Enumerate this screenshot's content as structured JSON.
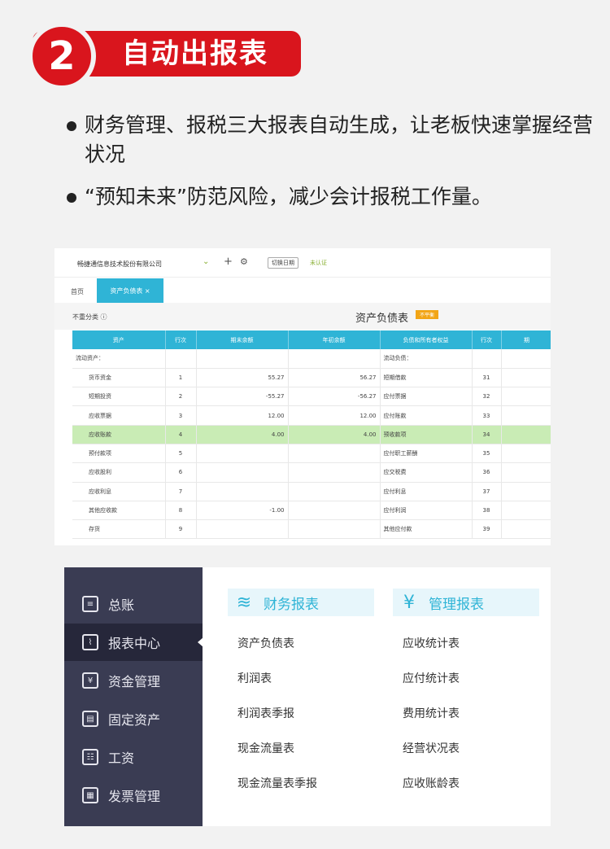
{
  "header": {
    "number": "2",
    "title": "自动出报表"
  },
  "bullets": [
    "财务管理、报税三大报表自动生成，让老板快速掌握经营状况",
    "“预知未来”防范风险，减少会计报税工作量。"
  ],
  "shot1": {
    "company": "畅捷通信息技术股份有限公司",
    "switch_label": "切换日期",
    "status": "未认证",
    "tab_home": "首页",
    "tab_active": "资产负债表 ×",
    "unclassified": "不重分类 ⓘ",
    "report_title": "资产负债表",
    "report_flag": "不平衡",
    "columns": [
      "资产",
      "行次",
      "期末余额",
      "年初余额",
      "负债和所有者权益",
      "行次",
      "期"
    ],
    "rows": [
      {
        "asset": "流动资产：",
        "line": "",
        "end": "",
        "start": "",
        "liab": "流动负债：",
        "line2": "",
        "hl": false,
        "indent": false
      },
      {
        "asset": "货币资金",
        "line": "1",
        "end": "55.27",
        "start": "56.27",
        "liab": "短期借款",
        "line2": "31",
        "hl": false,
        "indent": true
      },
      {
        "asset": "短期投资",
        "line": "2",
        "end": "-55.27",
        "start": "-56.27",
        "liab": "应付票据",
        "line2": "32",
        "hl": false,
        "indent": true
      },
      {
        "asset": "应收票据",
        "line": "3",
        "end": "12.00",
        "start": "12.00",
        "liab": "应付账款",
        "line2": "33",
        "hl": false,
        "indent": true
      },
      {
        "asset": "应收账款",
        "line": "4",
        "end": "4.00",
        "start": "4.00",
        "liab": "预收款项",
        "line2": "34",
        "hl": true,
        "indent": true
      },
      {
        "asset": "预付款项",
        "line": "5",
        "end": "",
        "start": "",
        "liab": "应付职工薪酬",
        "line2": "35",
        "hl": false,
        "indent": true
      },
      {
        "asset": "应收股利",
        "line": "6",
        "end": "",
        "start": "",
        "liab": "应交税费",
        "line2": "36",
        "hl": false,
        "indent": true
      },
      {
        "asset": "应收利息",
        "line": "7",
        "end": "",
        "start": "",
        "liab": "应付利息",
        "line2": "37",
        "hl": false,
        "indent": true
      },
      {
        "asset": "其他应收款",
        "line": "8",
        "end": "-1.00",
        "start": "",
        "liab": "应付利润",
        "line2": "38",
        "hl": false,
        "indent": true
      },
      {
        "asset": "存货",
        "line": "9",
        "end": "",
        "start": "",
        "liab": "其他应付款",
        "line2": "39",
        "hl": false,
        "indent": true
      }
    ]
  },
  "shot2": {
    "sidebar": [
      {
        "label": "总账",
        "icon": "ledger-icon",
        "glyph": "≡",
        "active": false
      },
      {
        "label": "报表中心",
        "icon": "chart-icon",
        "glyph": "⌇",
        "active": true
      },
      {
        "label": "资金管理",
        "icon": "money-icon",
        "glyph": "¥",
        "active": false
      },
      {
        "label": "固定资产",
        "icon": "asset-icon",
        "glyph": "▤",
        "active": false
      },
      {
        "label": "工资",
        "icon": "salary-icon",
        "glyph": "☷",
        "active": false
      },
      {
        "label": "发票管理",
        "icon": "invoice-icon",
        "glyph": "▦",
        "active": false
      }
    ],
    "finance": {
      "title": "财务报表",
      "items": [
        "资产负债表",
        "利润表",
        "利润表季报",
        "现金流量表",
        "现金流量表季报"
      ]
    },
    "management": {
      "title": "管理报表",
      "items": [
        "应收统计表",
        "应付统计表",
        "费用统计表",
        "经营状况表",
        "应收账龄表"
      ]
    }
  }
}
